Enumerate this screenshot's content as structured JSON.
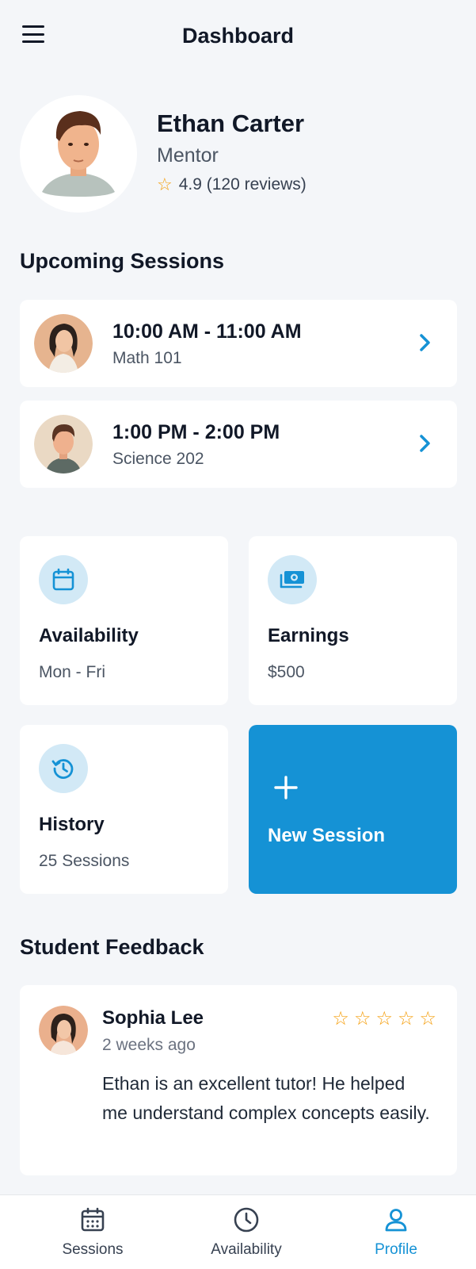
{
  "header": {
    "title": "Dashboard",
    "menu_icon": "hamburger-menu-icon"
  },
  "profile": {
    "name": "Ethan Carter",
    "role": "Mentor",
    "rating_text": "4.9 (120 reviews)",
    "rating_icon": "star-outline-icon"
  },
  "upcoming": {
    "title": "Upcoming Sessions",
    "sessions": [
      {
        "time": "10:00 AM - 11:00 AM",
        "course": "Math 101"
      },
      {
        "time": "1:00 PM - 2:00 PM",
        "course": "Science 202"
      }
    ]
  },
  "tiles": {
    "availability": {
      "title": "Availability",
      "sub": "Mon - Fri",
      "icon": "calendar-icon"
    },
    "earnings": {
      "title": "Earnings",
      "sub": "$500",
      "icon": "money-icon"
    },
    "history": {
      "title": "History",
      "sub": "25 Sessions",
      "icon": "history-icon"
    },
    "new_session": {
      "title": "New Session",
      "icon": "plus-icon"
    }
  },
  "feedback": {
    "title": "Student Feedback",
    "name": "Sophia Lee",
    "time": "2 weeks ago",
    "stars": 5,
    "text": "Ethan is an excellent tutor! He helped me understand complex concepts easily."
  },
  "nav": {
    "sessions": "Sessions",
    "availability": "Availability",
    "profile": "Profile",
    "active": "profile"
  },
  "colors": {
    "accent": "#1592d5",
    "star": "#f59e0b",
    "background": "#f4f6f9"
  }
}
